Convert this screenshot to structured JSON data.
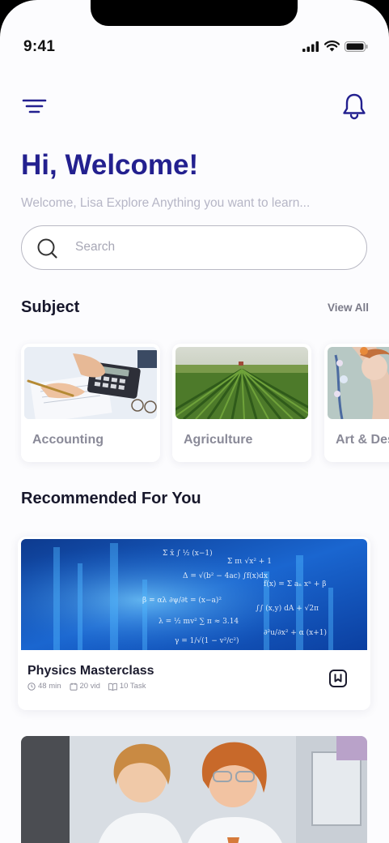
{
  "status_bar": {
    "time": "9:41"
  },
  "header": {
    "menu_icon": "filter-menu-icon",
    "notification_icon": "bell-icon"
  },
  "greeting": {
    "title": "Hi, Welcome!",
    "subtitle": "Welcome, Lisa Explore Anything you want to learn..."
  },
  "search": {
    "placeholder": "Search",
    "value": ""
  },
  "subjects": {
    "title": "Subject",
    "view_all": "View All",
    "items": [
      {
        "label": "Accounting"
      },
      {
        "label": "Agriculture"
      },
      {
        "label": "Art & Design"
      }
    ]
  },
  "recommended": {
    "title": "Recommended For You",
    "courses": [
      {
        "title": "Physics Masterclass",
        "duration": "48 min",
        "videos": "20 vid",
        "tasks": "10 Task"
      },
      {
        "title": ""
      }
    ]
  },
  "colors": {
    "accent": "#23208f",
    "muted": "#b6b6c6",
    "background": "#fcfcfe"
  }
}
